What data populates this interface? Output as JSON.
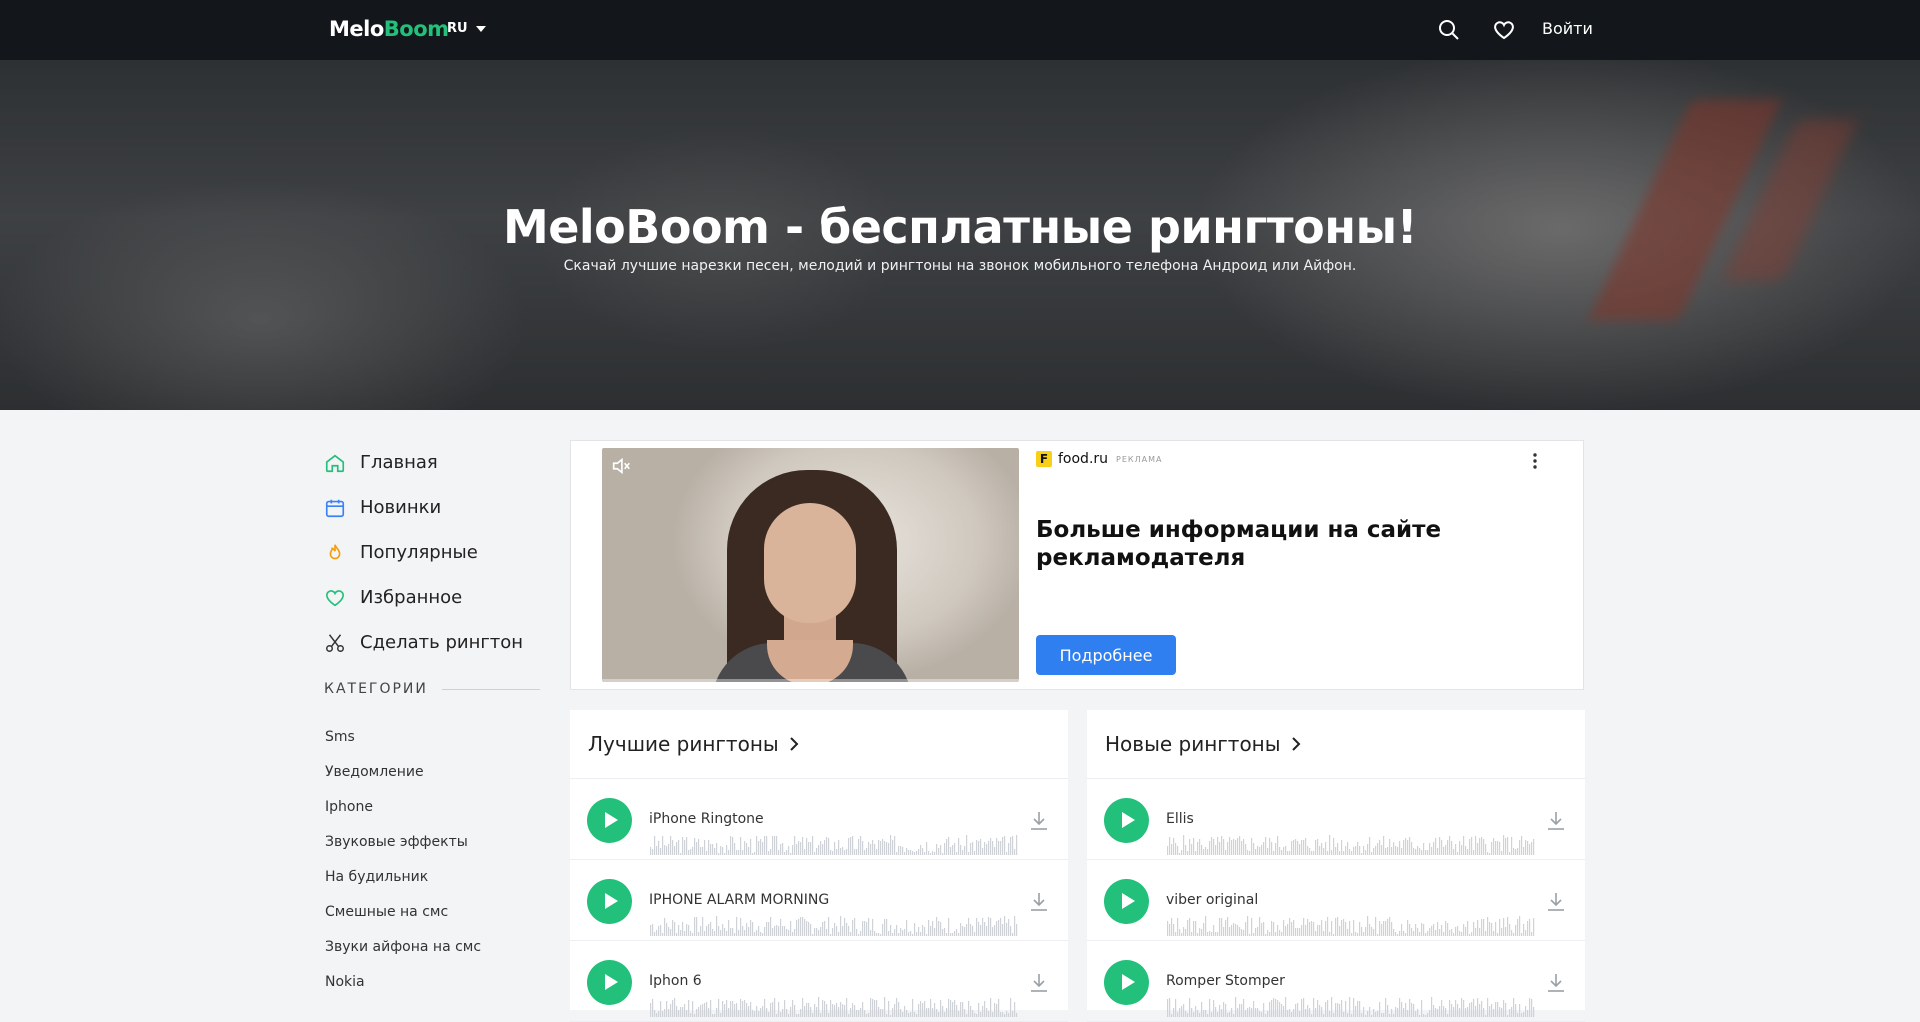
{
  "header": {
    "logo_main": "Melo",
    "logo_accent": "Boom",
    "lang": "RU",
    "login": "Войти"
  },
  "hero": {
    "title": "MeloBoom - бесплатные рингтоны!",
    "subtitle": "Скачай лучшие нарезки песен, мелодий и рингтоны на звонок мобильного телефона Андроид или Айфон."
  },
  "sidebar": {
    "nav": [
      {
        "label": "Главная",
        "icon": "home-icon"
      },
      {
        "label": "Новинки",
        "icon": "calendar-icon"
      },
      {
        "label": "Популярные",
        "icon": "fire-icon"
      },
      {
        "label": "Избранное",
        "icon": "heart-icon"
      },
      {
        "label": "Сделать рингтон",
        "icon": "scissors-icon"
      }
    ],
    "categories_heading": "КАТЕГОРИИ",
    "categories": [
      "Sms",
      "Уведомление",
      "Iphone",
      "Звуковые эффекты",
      "На будильник",
      "Смешные на смс",
      "Звуки айфона на смс",
      "Nokia"
    ]
  },
  "ad": {
    "brand_letter": "F",
    "brand": "food.ru",
    "tag": "РЕКЛАМА",
    "headline": "Больше информации на сайте рекламодателя",
    "button": "Подробнее"
  },
  "best": {
    "title": "Лучшие рингтоны",
    "items": [
      "iPhone Ringtone",
      "IPHONE ALARM MORNING",
      "Iphon 6"
    ]
  },
  "new": {
    "title": "Новые рингтоны",
    "items": [
      "Ellis",
      "viber original",
      "Romper Stomper"
    ]
  },
  "colors": {
    "accent": "#22c07a",
    "header_bg": "#13161a",
    "ad_button": "#2f7ff0"
  }
}
